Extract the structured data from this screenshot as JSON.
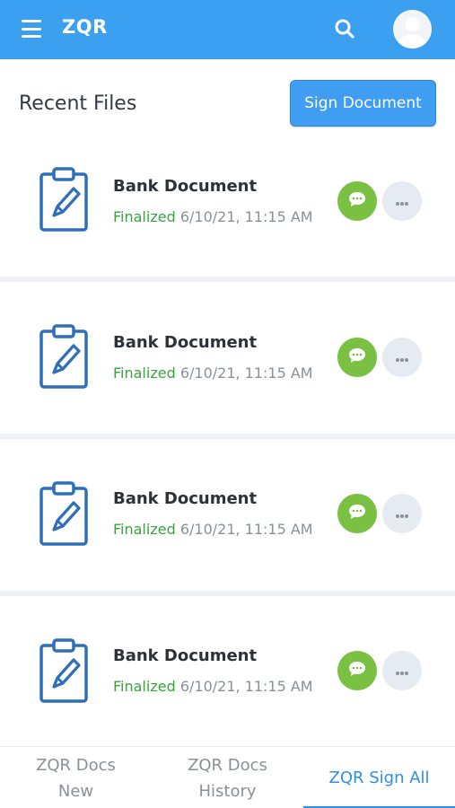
{
  "header": {
    "title": "ZQR",
    "menu_icon": "hamburger-menu-icon",
    "search_icon": "search-icon",
    "avatar_icon": "user-avatar-icon",
    "background": "#3aa0ef"
  },
  "recent": {
    "title": "Recent Files",
    "sign_button": "Sign Document"
  },
  "files": [
    {
      "name": "Bank Document",
      "status": "Finalized",
      "date": "6/10/21, 11:15 AM"
    },
    {
      "name": "Bank Document",
      "status": "Finalized",
      "date": "6/10/21, 11:15 AM"
    },
    {
      "name": "Bank Document",
      "status": "Finalized",
      "date": "6/10/21, 11:15 AM"
    },
    {
      "name": "Bank Document",
      "status": "Finalized",
      "date": "6/10/21, 11:15 AM"
    }
  ],
  "bottom_nav": {
    "tabs": [
      {
        "line1": "ZQR Docs",
        "line2": "New"
      },
      {
        "line1": "ZQR Docs",
        "line2": "History"
      },
      {
        "line1": "ZQR Sign All",
        "line2": ""
      }
    ],
    "active_index": 2
  },
  "colors": {
    "primary": "#3aa0ef",
    "status_green": "#36a53c",
    "chat_green": "#7ac043",
    "more_gray": "#e6ebf1",
    "doc_icon_blue": "#2f6fb8"
  }
}
